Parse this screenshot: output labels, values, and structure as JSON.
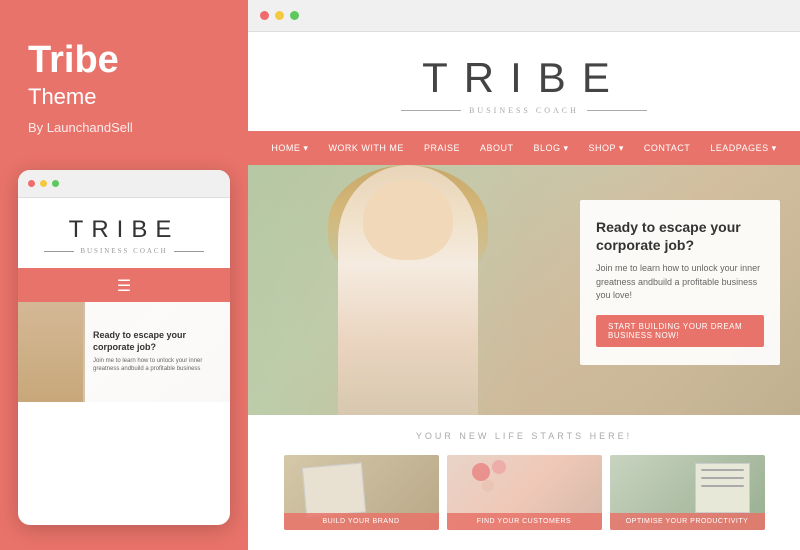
{
  "left": {
    "title": "Tribe",
    "subtitle": "Theme",
    "byline": "By LaunchandSell"
  },
  "mobile": {
    "logo_text": "TRIBE",
    "logo_sub": "BUSINESS COACH",
    "hero_title": "Ready to escape your corporate job?",
    "hero_desc": "Join me to learn how to unlock your inner greatness andbuild a profitable business"
  },
  "desktop": {
    "logo_text": "TRIBE",
    "logo_sub": "BUSINESS COACH",
    "nav_items": [
      "HOME ▾",
      "WORK WITH ME",
      "PRAISE",
      "ABOUT",
      "BLOG ▾",
      "SHOP ▾",
      "CONTACT",
      "LEADPAGES ▾"
    ],
    "hero_title": "Ready to escape your corporate job?",
    "hero_desc": "Join me to learn how to unlock your inner greatness andbuild a profitable business you love!",
    "cta_label": "Start building your dream business now!",
    "tagline": "YOUR NEW LIFE STARTS HERE!",
    "cards": [
      {
        "label": "Build Your Brand"
      },
      {
        "label": "Find Your Customers"
      },
      {
        "label": "Optimise Your Productivity"
      }
    ]
  },
  "browser_dots": {
    "red": "#f06b6b",
    "yellow": "#f5c842",
    "green": "#5dc95d"
  }
}
